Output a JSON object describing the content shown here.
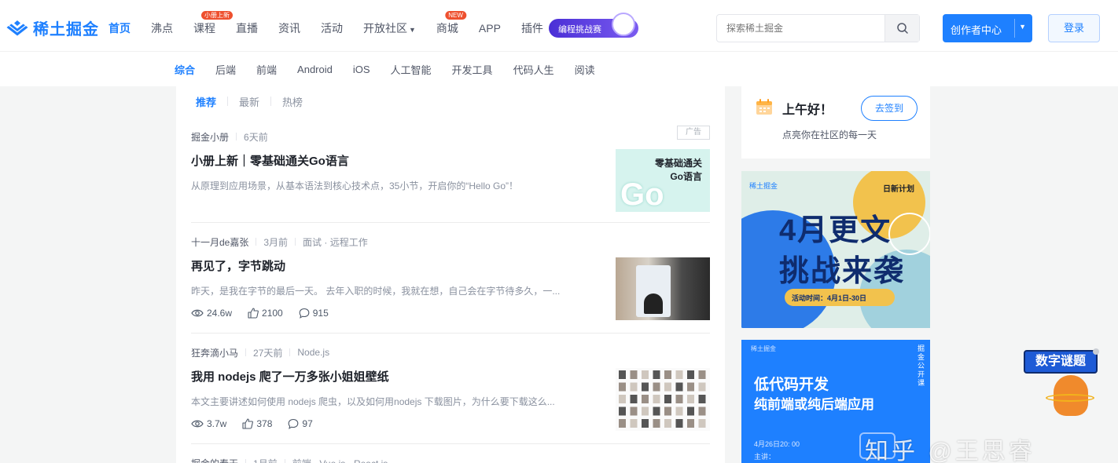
{
  "brand": {
    "name": "稀土掘金",
    "accent": "#1e80ff"
  },
  "nav": {
    "items": [
      {
        "label": "首页",
        "active": true
      },
      {
        "label": "沸点"
      },
      {
        "label": "课程",
        "badge": "小册上新"
      },
      {
        "label": "直播"
      },
      {
        "label": "资讯"
      },
      {
        "label": "活动"
      },
      {
        "label": "开放社区",
        "dropdown": true
      },
      {
        "label": "商城",
        "badge": "NEW"
      },
      {
        "label": "APP"
      },
      {
        "label": "插件"
      }
    ],
    "promo_label": "编程挑战赛"
  },
  "search": {
    "placeholder": "探索稀土掘金"
  },
  "header_actions": {
    "creator_label": "创作者中心",
    "login_label": "登录"
  },
  "subnav": {
    "items": [
      "综合",
      "后端",
      "前端",
      "Android",
      "iOS",
      "人工智能",
      "开发工具",
      "代码人生",
      "阅读"
    ],
    "active_index": 0
  },
  "feed": {
    "tabs": [
      "推荐",
      "最新",
      "热榜"
    ],
    "active_tab": 0,
    "articles": [
      {
        "author": "掘金小册",
        "time": "6天前",
        "tags": "",
        "title": "小册上新｜零基础通关Go语言",
        "desc": "从原理到应用场景，从基本语法到核心技术点，35小节，开启你的“Hello Go”！",
        "ad_label": "广告",
        "thumb_text_1": "零基础通关",
        "thumb_text_2": "Go语言",
        "thumb_logo": "Go"
      },
      {
        "author": "十一月de嘉张",
        "time": "3月前",
        "tags": "面试 · 远程工作",
        "title": "再见了，字节跳动",
        "desc": "昨天，是我在字节的最后一天。 去年入职的时候，我就在想，自己会在字节待多久，一...",
        "views": "24.6w",
        "likes": "2100",
        "comments": "915"
      },
      {
        "author": "狂奔滴小马",
        "time": "27天前",
        "tags": "Node.js",
        "title": "我用 nodejs 爬了一万多张小姐姐壁纸",
        "desc": "本文主要讲述如何使用 nodejs 爬虫，以及如何用nodejs 下载图片，为什么要下载这么...",
        "views": "3.7w",
        "likes": "378",
        "comments": "97"
      },
      {
        "author": "掘金的春天",
        "time": "1月前",
        "tags": "前端 · Vue.js · React.js"
      }
    ]
  },
  "sidebar": {
    "greeting": "上午好！",
    "checkin_label": "去签到",
    "subtitle": "点亮你在社区的每一天",
    "banner1": {
      "top_tag": "稀土掘金",
      "corner": "日新计划",
      "line1": "4月更文",
      "line2": "挑战来袭",
      "period": "活动时间：4月1日-30日"
    },
    "banner2": {
      "top_tag": "稀土掘金",
      "side": "掘金公开课",
      "line1": "低代码开发",
      "line2": "纯前端或纯后端应用",
      "date": "4月26日20: 00",
      "speaker": "主讲："
    }
  },
  "float_badge": {
    "label": "数字谜题"
  },
  "watermark": "知乎 @王思睿"
}
